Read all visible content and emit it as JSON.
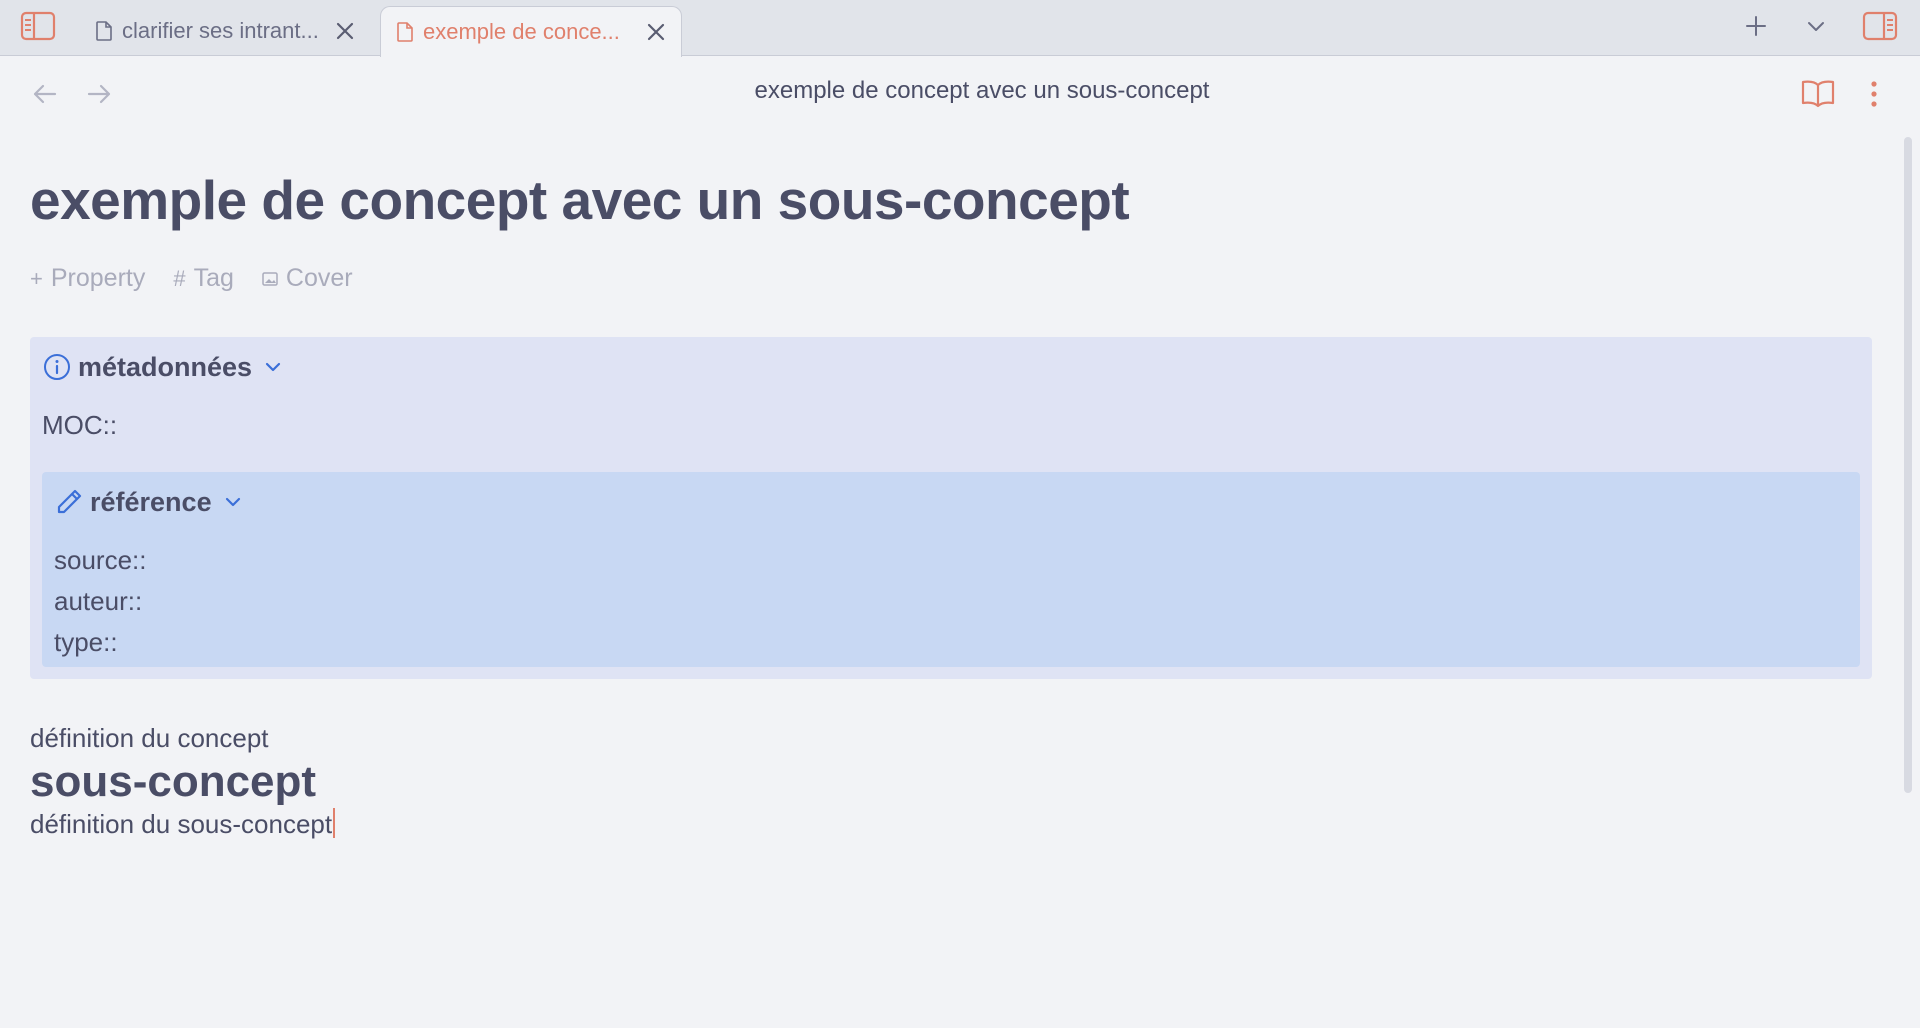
{
  "tabs": [
    {
      "title": "clarifier ses intrant...",
      "active": false
    },
    {
      "title": "exemple de conce...",
      "active": true
    }
  ],
  "header": {
    "view_title": "exemple de concept avec un sous-concept"
  },
  "note": {
    "title": "exemple de concept avec un sous-concept",
    "properties": {
      "property": "Property",
      "tag": "Tag",
      "cover": "Cover"
    },
    "callout_meta": {
      "title": "métadonnées",
      "moc": "MOC::"
    },
    "callout_ref": {
      "title": "référence",
      "fields": [
        "source::",
        "auteur::",
        "type::"
      ]
    },
    "definition": "définition du concept",
    "subheading": "sous-concept",
    "sub_definition": "définition du sous-concept"
  },
  "colors": {
    "accent": "#e0806c",
    "callout_info": "#dfe3f4",
    "callout_ref": "#c8d8f3",
    "icon_blue": "#3b6fd8"
  }
}
